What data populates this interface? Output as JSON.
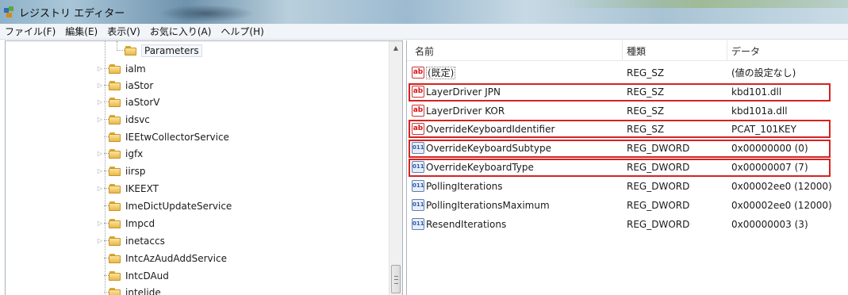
{
  "window": {
    "title": "レジストリ エディター"
  },
  "menu": [
    {
      "label": "ファイル(F)"
    },
    {
      "label": "編集(E)"
    },
    {
      "label": "表示(V)"
    },
    {
      "label": "お気に入り(A)"
    },
    {
      "label": "ヘルプ(H)"
    }
  ],
  "tree": {
    "items": [
      {
        "label": "Parameters"
      },
      {
        "label": "ialm"
      },
      {
        "label": "iaStor"
      },
      {
        "label": "iaStorV"
      },
      {
        "label": "idsvc"
      },
      {
        "label": "IEEtwCollectorService"
      },
      {
        "label": "igfx"
      },
      {
        "label": "iirsp"
      },
      {
        "label": "IKEEXT"
      },
      {
        "label": "ImeDictUpdateService"
      },
      {
        "label": "Impcd"
      },
      {
        "label": "inetaccs"
      },
      {
        "label": "IntcAzAudAddService"
      },
      {
        "label": "IntcDAud"
      },
      {
        "label": "intelide"
      }
    ]
  },
  "values_table": {
    "headers": {
      "name": "名前",
      "type": "種類",
      "data": "データ"
    },
    "rows": [
      {
        "name": "(既定)",
        "type": "REG_SZ",
        "data": "(値の設定なし)",
        "icon": "string-value-icon"
      },
      {
        "name": "LayerDriver JPN",
        "type": "REG_SZ",
        "data": "kbd101.dll",
        "icon": "string-value-icon"
      },
      {
        "name": "LayerDriver KOR",
        "type": "REG_SZ",
        "data": "kbd101a.dll",
        "icon": "string-value-icon"
      },
      {
        "name": "OverrideKeyboardIdentifier",
        "type": "REG_SZ",
        "data": "PCAT_101KEY",
        "icon": "string-value-icon"
      },
      {
        "name": "OverrideKeyboardSubtype",
        "type": "REG_DWORD",
        "data": "0x00000000 (0)",
        "icon": "dword-value-icon"
      },
      {
        "name": "OverrideKeyboardType",
        "type": "REG_DWORD",
        "data": "0x00000007 (7)",
        "icon": "dword-value-icon"
      },
      {
        "name": "PollingIterations",
        "type": "REG_DWORD",
        "data": "0x00002ee0 (12000)",
        "icon": "dword-value-icon"
      },
      {
        "name": "PollingIterationsMaximum",
        "type": "REG_DWORD",
        "data": "0x00002ee0 (12000)",
        "icon": "dword-value-icon"
      },
      {
        "name": "ResendIterations",
        "type": "REG_DWORD",
        "data": "0x00000003 (3)",
        "icon": "dword-value-icon"
      }
    ]
  },
  "icons": {
    "sz_text": "ab",
    "dword_text": "011"
  },
  "colors": {
    "highlight_box": "#d62222"
  }
}
